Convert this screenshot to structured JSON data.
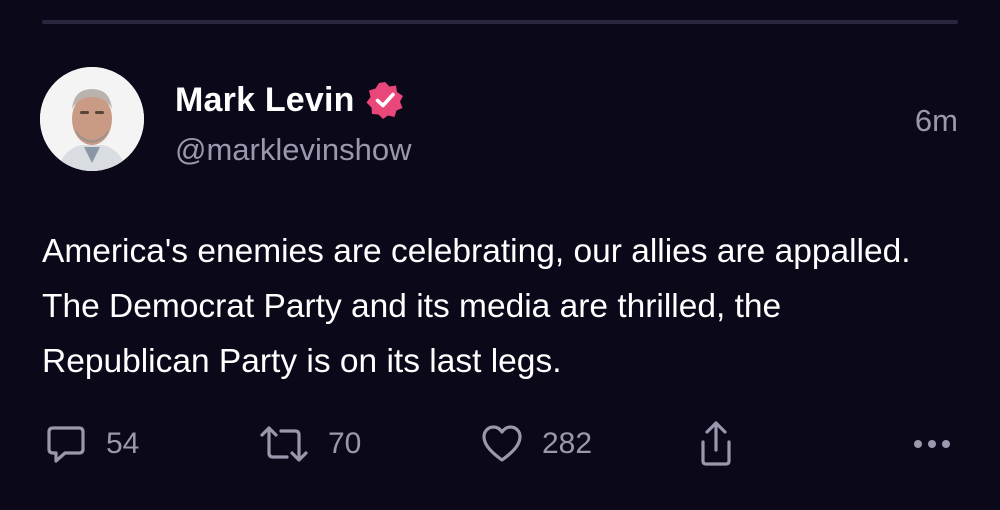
{
  "tweet": {
    "author_name": "Mark Levin",
    "handle": "@marklevinshow",
    "time": "6m",
    "text": "America's enemies are celebrating, our allies are appalled. The Democrat Party and its media are thrilled, the Republican Party is on its last legs.",
    "verified_badge_color": "#e9467a"
  },
  "actions": {
    "replies": "54",
    "reposts": "70",
    "likes": "282"
  },
  "icons": {
    "reply": "reply-icon",
    "repost": "repost-icon",
    "like": "heart-icon",
    "share": "share-icon",
    "more": "more-icon",
    "verified": "verified-badge-icon"
  },
  "colors": {
    "background": "#0b0819",
    "muted_text": "#9b98ae",
    "primary_text": "#ffffff"
  }
}
